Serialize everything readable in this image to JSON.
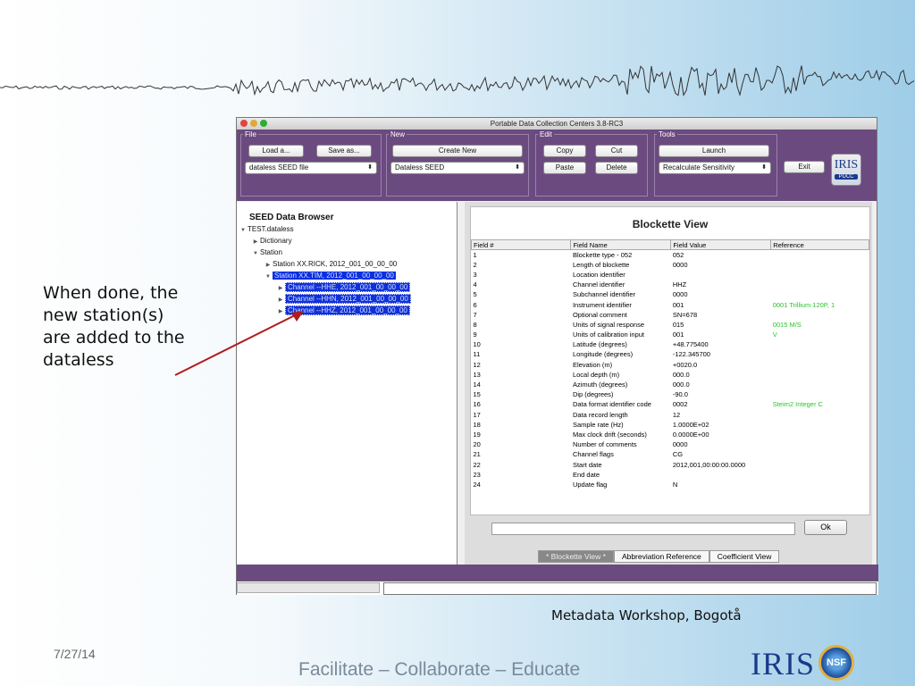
{
  "slide": {
    "annotation_lines": [
      "When done, the",
      "new station(s)",
      "are added to the",
      "dataless"
    ],
    "caption": "Metadata Workshop, Bogotå",
    "date": "7/27/14",
    "tagline": "Facilitate – Collaborate – Educate",
    "logo_iris": "IRIS",
    "logo_nsf": "NSF"
  },
  "app": {
    "title": "Portable Data Collection Centers 3.8-RC3",
    "toolbar": {
      "file_label": "File",
      "load_label": "Load a...",
      "saveas_label": "Save as...",
      "file_type_select": "dataless SEED file",
      "new_label": "New",
      "create_new_label": "Create New",
      "new_type_select": "Dataless SEED",
      "edit_label": "Edit",
      "copy_label": "Copy",
      "cut_label": "Cut",
      "paste_label": "Paste",
      "delete_label": "Delete",
      "tools_label": "Tools",
      "launch_label": "Launch",
      "tool_select": "Recalculate Sensitivity",
      "exit_label": "Exit",
      "logo_text": "IRIS",
      "logo_sub": "PDCC"
    },
    "browser": {
      "title": "SEED Data Browser",
      "nodes": [
        {
          "label": "TEST.dataless",
          "indent": 0,
          "tri": "▼",
          "selected": false
        },
        {
          "label": "Dictionary",
          "indent": 1,
          "tri": "▶",
          "selected": false
        },
        {
          "label": "Station",
          "indent": 1,
          "tri": "▼",
          "selected": false
        },
        {
          "label": "Station XX.RICK, 2012_001_00_00_00",
          "indent": 2,
          "tri": "▶",
          "selected": false
        },
        {
          "label": "Station XX.TIM, 2012_001_00_00_00",
          "indent": 2,
          "tri": "▼",
          "selected": true
        },
        {
          "label": "Channel --HHE, 2012_001_00_00_00",
          "indent": 3,
          "tri": "▶",
          "selected": true
        },
        {
          "label": "Channel --HHN, 2012_001_00_00_00",
          "indent": 3,
          "tri": "▶",
          "selected": true
        },
        {
          "label": "Channel --HHZ, 2012_001_00_00_00",
          "indent": 3,
          "tri": "▶",
          "selected": true
        }
      ]
    },
    "blockette": {
      "title": "Blockette View",
      "headers": [
        "Field #",
        "Field Name",
        "Field Value",
        "Reference"
      ],
      "rows": [
        [
          "1",
          "Blockette type - 052",
          "052",
          ""
        ],
        [
          "2",
          "Length of blockette",
          "0000",
          ""
        ],
        [
          "3",
          "Location identifier",
          "",
          ""
        ],
        [
          "4",
          "Channel identifier",
          "HHZ",
          ""
        ],
        [
          "5",
          "Subchannel identifier",
          "0000",
          ""
        ],
        [
          "6",
          "Instrument identifier",
          "001",
          "0001 Trillium 120P, 1"
        ],
        [
          "7",
          "Optional comment",
          "SN=678",
          ""
        ],
        [
          "8",
          "Units of signal response",
          "015",
          "0015 M/S"
        ],
        [
          "9",
          "Units of calibration input",
          "001",
          "V"
        ],
        [
          "10",
          "Latitude (degrees)",
          "+48.775400",
          ""
        ],
        [
          "11",
          "Longitude (degrees)",
          "-122.345700",
          ""
        ],
        [
          "12",
          "Elevation (m)",
          "+0020.0",
          ""
        ],
        [
          "13",
          "Local depth (m)",
          "000.0",
          ""
        ],
        [
          "14",
          "Azimuth (degrees)",
          "000.0",
          ""
        ],
        [
          "15",
          "Dip (degrees)",
          "-90.0",
          ""
        ],
        [
          "16",
          "Data format identifier code",
          "0002",
          "Steim2 Integer C"
        ],
        [
          "17",
          "Data record length",
          "12",
          ""
        ],
        [
          "18",
          "Sample rate (Hz)",
          "1.0000E+02",
          ""
        ],
        [
          "19",
          "Max clock drift (seconds)",
          "0.0000E+00",
          ""
        ],
        [
          "20",
          "Number of comments",
          "0000",
          ""
        ],
        [
          "21",
          "Channel flags",
          "CG",
          ""
        ],
        [
          "22",
          "Start date",
          "2012,001,00:00:00.0000",
          ""
        ],
        [
          "23",
          "End date",
          "",
          ""
        ],
        [
          "24",
          "Update flag",
          "N",
          ""
        ]
      ],
      "ok_label": "Ok",
      "tabs": [
        "* Blockette View *",
        "Abbreviation Reference",
        "Coefficient View"
      ]
    }
  },
  "colors": {
    "toolbar_bg": "#6b4a80",
    "selection": "#0a2ee0",
    "reference_text": "#2ac42a",
    "arrow": "#b01c1c"
  }
}
